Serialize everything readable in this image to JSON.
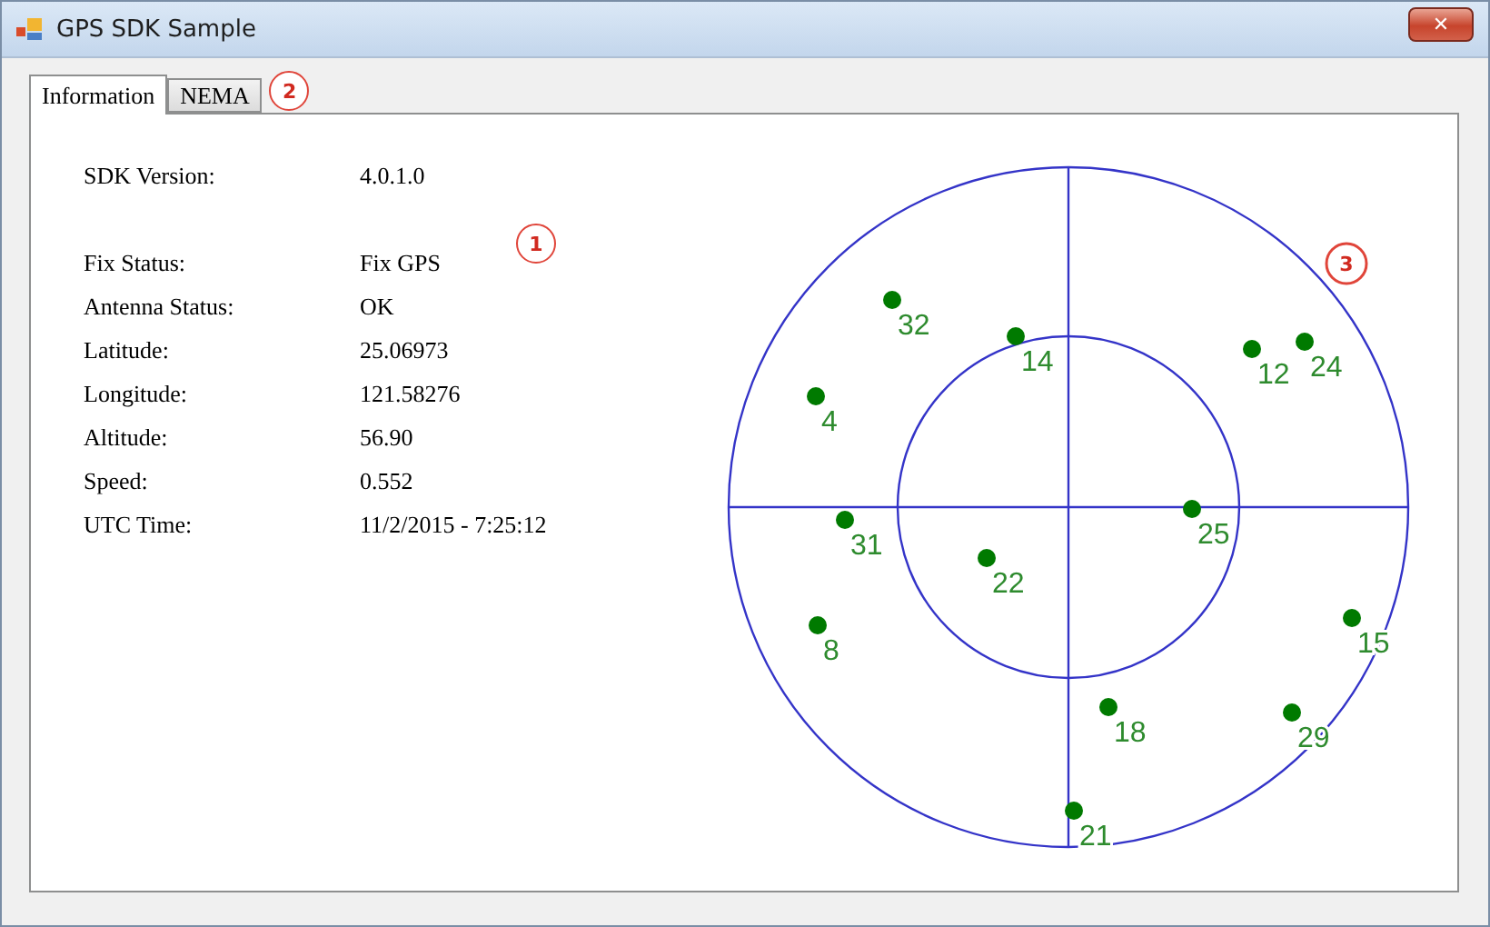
{
  "window": {
    "title": "GPS SDK Sample",
    "close": "✕"
  },
  "tabs": [
    {
      "label": "Information",
      "selected": true
    },
    {
      "label": "NEMA",
      "selected": false
    }
  ],
  "info": {
    "version": {
      "label": "SDK Version:",
      "value": "4.0.1.0"
    },
    "fields": [
      {
        "label": "Fix Status:",
        "value": "Fix GPS"
      },
      {
        "label": "Antenna Status:",
        "value": "OK"
      },
      {
        "label": "Latitude:",
        "value": "25.06973"
      },
      {
        "label": "Longitude:",
        "value": "121.58276"
      },
      {
        "label": "Altitude:",
        "value": "56.90"
      },
      {
        "label": "Speed:",
        "value": "0.552"
      },
      {
        "label": "UTC Time:",
        "value": "11/2/2015 - 7:25:12"
      }
    ]
  },
  "callouts": [
    "1",
    "2",
    "3"
  ],
  "satellites": [
    "32",
    "14",
    "12",
    "24",
    "4",
    "25",
    "31",
    "22",
    "8",
    "15",
    "18",
    "29",
    "21"
  ]
}
